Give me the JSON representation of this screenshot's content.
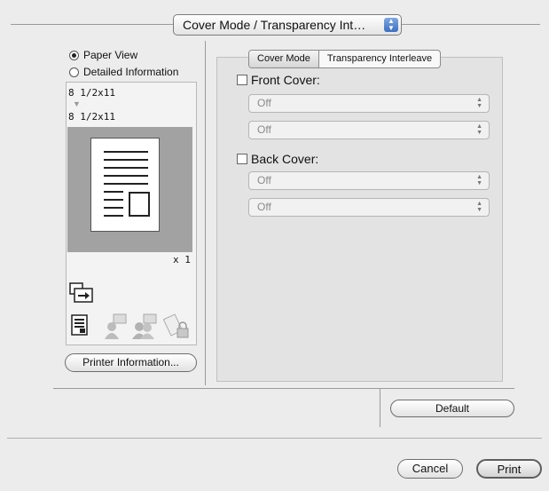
{
  "header": {
    "popup_value": "Cover Mode / Transparency Int…",
    "popup_arrows_icon": "up-down-arrows-icon"
  },
  "left_panel": {
    "view_options": [
      {
        "label": "Paper View",
        "selected": true
      },
      {
        "label": "Detailed Information",
        "selected": false
      }
    ],
    "paper_source_size": "8 1/2x11",
    "paper_output_size": "8 1/2x11",
    "copies": "x 1",
    "icons": [
      "feed-direction-icon",
      "document-icon",
      "user-auth-icon",
      "account-track-icon",
      "security-icon"
    ],
    "printer_info_button": "Printer Information..."
  },
  "tabs": [
    {
      "label": "Cover Mode",
      "selected": true
    },
    {
      "label": "Transparency Interleave",
      "selected": false
    }
  ],
  "cover_mode": {
    "front_cover": {
      "label": "Front Cover:",
      "checked": false,
      "selects": [
        "Off",
        "Off"
      ]
    },
    "back_cover": {
      "label": "Back Cover:",
      "checked": false,
      "selects": [
        "Off",
        "Off"
      ]
    }
  },
  "buttons": {
    "default": "Default",
    "cancel": "Cancel",
    "print": "Print"
  }
}
